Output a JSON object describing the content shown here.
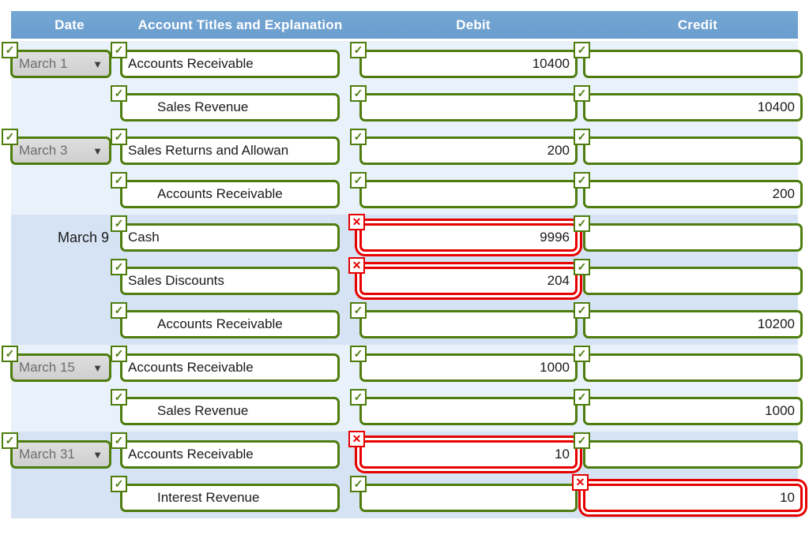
{
  "header": {
    "bg_color": "#6a9fd0",
    "text_color": "#ffffff",
    "columns": [
      {
        "key": "date",
        "label": "Date"
      },
      {
        "key": "account",
        "label": "Account Titles and Explanation"
      },
      {
        "key": "debit",
        "label": "Debit"
      },
      {
        "key": "credit",
        "label": "Credit"
      }
    ]
  },
  "status": {
    "ok_icon": "check-icon",
    "error_icon": "cross-icon",
    "ok_color": "#4e7d0e",
    "error_color": "#e60000"
  },
  "rows": [
    {
      "band": "light",
      "date": {
        "type": "select",
        "value": "March 1",
        "status": "ok"
      },
      "account": {
        "value": "Accounts Receivable",
        "indent": false,
        "status": "ok"
      },
      "debit": {
        "value": "10400",
        "status": "ok"
      },
      "credit": {
        "value": "",
        "status": "ok"
      }
    },
    {
      "band": "light",
      "date": {
        "type": "none",
        "value": "",
        "status": "none"
      },
      "account": {
        "value": "Sales Revenue",
        "indent": true,
        "status": "ok"
      },
      "debit": {
        "value": "",
        "status": "ok"
      },
      "credit": {
        "value": "10400",
        "status": "ok"
      }
    },
    {
      "band": "light",
      "date": {
        "type": "select",
        "value": "March 3",
        "status": "ok"
      },
      "account": {
        "value": "Sales Returns and Allowan",
        "indent": false,
        "status": "ok"
      },
      "debit": {
        "value": "200",
        "status": "ok"
      },
      "credit": {
        "value": "",
        "status": "ok"
      }
    },
    {
      "band": "light",
      "date": {
        "type": "none",
        "value": "",
        "status": "none"
      },
      "account": {
        "value": "Accounts Receivable",
        "indent": true,
        "status": "ok"
      },
      "debit": {
        "value": "",
        "status": "ok"
      },
      "credit": {
        "value": "200",
        "status": "ok"
      }
    },
    {
      "band": "dark",
      "date": {
        "type": "text",
        "value": "March 9",
        "status": "none"
      },
      "account": {
        "value": "Cash",
        "indent": false,
        "status": "ok"
      },
      "debit": {
        "value": "9996",
        "status": "error"
      },
      "credit": {
        "value": "",
        "status": "ok"
      }
    },
    {
      "band": "dark",
      "date": {
        "type": "none",
        "value": "",
        "status": "none"
      },
      "account": {
        "value": "Sales Discounts",
        "indent": false,
        "status": "ok"
      },
      "debit": {
        "value": "204",
        "status": "error"
      },
      "credit": {
        "value": "",
        "status": "ok"
      }
    },
    {
      "band": "dark",
      "date": {
        "type": "none",
        "value": "",
        "status": "none"
      },
      "account": {
        "value": "Accounts Receivable",
        "indent": true,
        "status": "ok"
      },
      "debit": {
        "value": "",
        "status": "ok"
      },
      "credit": {
        "value": "10200",
        "status": "ok"
      }
    },
    {
      "band": "light",
      "date": {
        "type": "select",
        "value": "March 15",
        "status": "ok"
      },
      "account": {
        "value": "Accounts Receivable",
        "indent": false,
        "status": "ok"
      },
      "debit": {
        "value": "1000",
        "status": "ok"
      },
      "credit": {
        "value": "",
        "status": "ok"
      }
    },
    {
      "band": "light",
      "date": {
        "type": "none",
        "value": "",
        "status": "none"
      },
      "account": {
        "value": "Sales Revenue",
        "indent": true,
        "status": "ok"
      },
      "debit": {
        "value": "",
        "status": "ok"
      },
      "credit": {
        "value": "1000",
        "status": "ok"
      }
    },
    {
      "band": "dark",
      "date": {
        "type": "select",
        "value": "March 31",
        "status": "ok"
      },
      "account": {
        "value": "Accounts Receivable",
        "indent": false,
        "status": "ok"
      },
      "debit": {
        "value": "10",
        "status": "error"
      },
      "credit": {
        "value": "",
        "status": "ok"
      }
    },
    {
      "band": "dark",
      "date": {
        "type": "none",
        "value": "",
        "status": "none"
      },
      "account": {
        "value": "Interest Revenue",
        "indent": true,
        "status": "ok"
      },
      "debit": {
        "value": "",
        "status": "ok"
      },
      "credit": {
        "value": "10",
        "status": "error"
      }
    }
  ],
  "select_caret": "▼"
}
